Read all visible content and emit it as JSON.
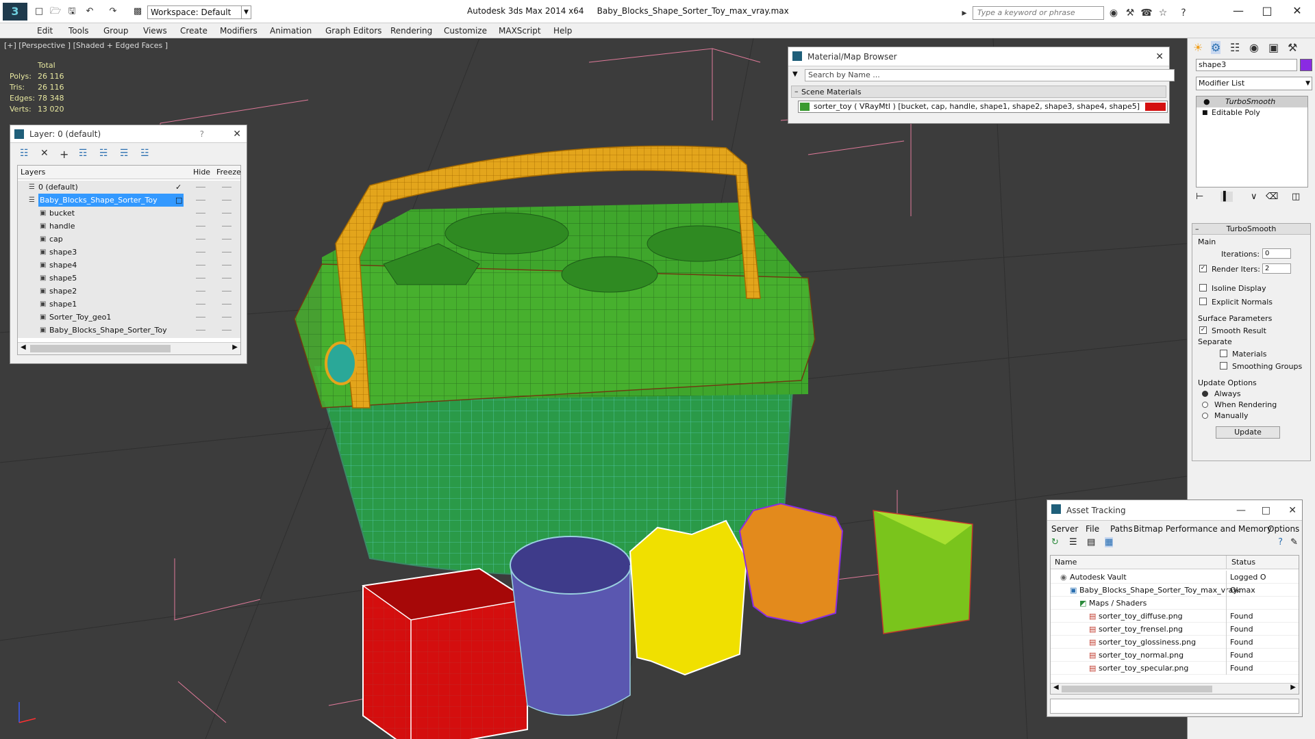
{
  "app": {
    "title": "Autodesk 3ds Max  2014 x64",
    "file": "Baby_Blocks_Shape_Sorter_Toy_max_vray.max",
    "workspace": "Workspace: Default",
    "search_placeholder": "Type a keyword or phrase"
  },
  "menu": [
    "Edit",
    "Tools",
    "Group",
    "Views",
    "Create",
    "Modifiers",
    "Animation",
    "Graph Editors",
    "Rendering",
    "Customize",
    "MAXScript",
    "Help"
  ],
  "viewport": {
    "label": "[+] [Perspective ] [Shaded + Edged Faces ]",
    "stats": {
      "header": "Total",
      "rows": [
        {
          "k": "Polys:",
          "v": "26 116"
        },
        {
          "k": "Tris:",
          "v": "26 116"
        },
        {
          "k": "Edges:",
          "v": "78 348"
        },
        {
          "k": "Verts:",
          "v": "13 020"
        }
      ]
    }
  },
  "layer_panel": {
    "title": "Layer: 0 (default)",
    "help": "?",
    "columns": {
      "layers": "Layers",
      "hide": "Hide",
      "freeze": "Freeze"
    },
    "rows": [
      {
        "name": "0 (default)",
        "level": 0,
        "check": true,
        "selected": false
      },
      {
        "name": "Baby_Blocks_Shape_Sorter_Toy",
        "level": 0,
        "check": false,
        "selected": true
      },
      {
        "name": "bucket",
        "level": 1
      },
      {
        "name": "handle",
        "level": 1
      },
      {
        "name": "cap",
        "level": 1
      },
      {
        "name": "shape3",
        "level": 1
      },
      {
        "name": "shape4",
        "level": 1
      },
      {
        "name": "shape5",
        "level": 1
      },
      {
        "name": "shape2",
        "level": 1
      },
      {
        "name": "shape1",
        "level": 1
      },
      {
        "name": "Sorter_Toy_geo1",
        "level": 1
      },
      {
        "name": "Baby_Blocks_Shape_Sorter_Toy",
        "level": 1
      }
    ]
  },
  "material_browser": {
    "title": "Material/Map Browser",
    "search_placeholder": "Search by Name ...",
    "section": "Scene Materials",
    "item": "sorter_toy  ( VRayMtl )  [bucket, cap, handle, shape1, shape2, shape3, shape4, shape5]"
  },
  "command_panel": {
    "object_name": "shape3",
    "object_color": "#8a2be2",
    "modifier_list": "Modifier List",
    "stack": [
      "TurboSmooth",
      "Editable Poly"
    ],
    "rollout_title": "TurboSmooth",
    "main_label": "Main",
    "iterations_label": "Iterations:",
    "iterations_value": "0",
    "render_iters_label": "Render Iters:",
    "render_iters_value": "2",
    "isoline": "Isoline Display",
    "explicit": "Explicit Normals",
    "surface_params": "Surface Parameters",
    "smooth_result": "Smooth Result",
    "separate": "Separate",
    "materials": "Materials",
    "smoothing_groups": "Smoothing Groups",
    "update_options": "Update Options",
    "always": "Always",
    "when_rendering": "When Rendering",
    "manually": "Manually",
    "update_button": "Update"
  },
  "asset_tracking": {
    "title": "Asset Tracking",
    "menu": [
      "Server",
      "File",
      "Paths",
      "Bitmap Performance and Memory",
      "Options"
    ],
    "columns": {
      "name": "Name",
      "status": "Status"
    },
    "rows": [
      {
        "name": "Autodesk Vault",
        "status": "Logged O",
        "indent": 1,
        "icon": "vault"
      },
      {
        "name": "Baby_Blocks_Shape_Sorter_Toy_max_vray.max",
        "status": "Ok",
        "indent": 2,
        "icon": "max"
      },
      {
        "name": "Maps / Shaders",
        "status": "",
        "indent": 3,
        "icon": "maps"
      },
      {
        "name": "sorter_toy_diffuse.png",
        "status": "Found",
        "indent": 4,
        "icon": "png"
      },
      {
        "name": "sorter_toy_frensel.png",
        "status": "Found",
        "indent": 4,
        "icon": "png"
      },
      {
        "name": "sorter_toy_glossiness.png",
        "status": "Found",
        "indent": 4,
        "icon": "png"
      },
      {
        "name": "sorter_toy_normal.png",
        "status": "Found",
        "indent": 4,
        "icon": "png"
      },
      {
        "name": "sorter_toy_specular.png",
        "status": "Found",
        "indent": 4,
        "icon": "png"
      }
    ]
  },
  "colors": {
    "viewport_bg": "#3c3c3c",
    "selection_blue": "#3399ff",
    "bucket_green": "#3d9a2a",
    "handle_orange": "#e3a51c"
  }
}
